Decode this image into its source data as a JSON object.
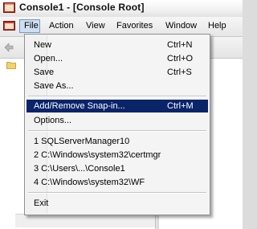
{
  "window": {
    "title": "Console1 - [Console Root]"
  },
  "menubar": {
    "items": [
      {
        "label": "File"
      },
      {
        "label": "Action"
      },
      {
        "label": "View"
      },
      {
        "label": "Favorites"
      },
      {
        "label": "Window"
      },
      {
        "label": "Help"
      }
    ],
    "active": "File"
  },
  "file_menu": {
    "new": {
      "label": "New",
      "shortcut": "Ctrl+N"
    },
    "open": {
      "label": "Open...",
      "shortcut": "Ctrl+O"
    },
    "save": {
      "label": "Save",
      "shortcut": "Ctrl+S"
    },
    "save_as": {
      "label": "Save As..."
    },
    "add_remove_snapin": {
      "label": "Add/Remove Snap-in...",
      "shortcut": "Ctrl+M"
    },
    "options": {
      "label": "Options..."
    },
    "recent": [
      {
        "label": "1 SQLServerManager10"
      },
      {
        "label": "2 C:\\Windows\\system32\\certmgr"
      },
      {
        "label": "3 C:\\Users\\...\\Console1"
      },
      {
        "label": "4 C:\\Windows\\system32\\WF"
      }
    ],
    "exit": {
      "label": "Exit"
    },
    "highlighted": "Add/Remove Snap-in..."
  },
  "icons": {
    "app": "mmc-console-icon",
    "menubar": "mmc-console-icon",
    "toolbar_back": "back-arrow-icon",
    "tree": "folder-icon"
  },
  "colors": {
    "highlight": "#0a246a",
    "highlight_text": "#ffffff",
    "menu_active": "#d0dff0"
  }
}
